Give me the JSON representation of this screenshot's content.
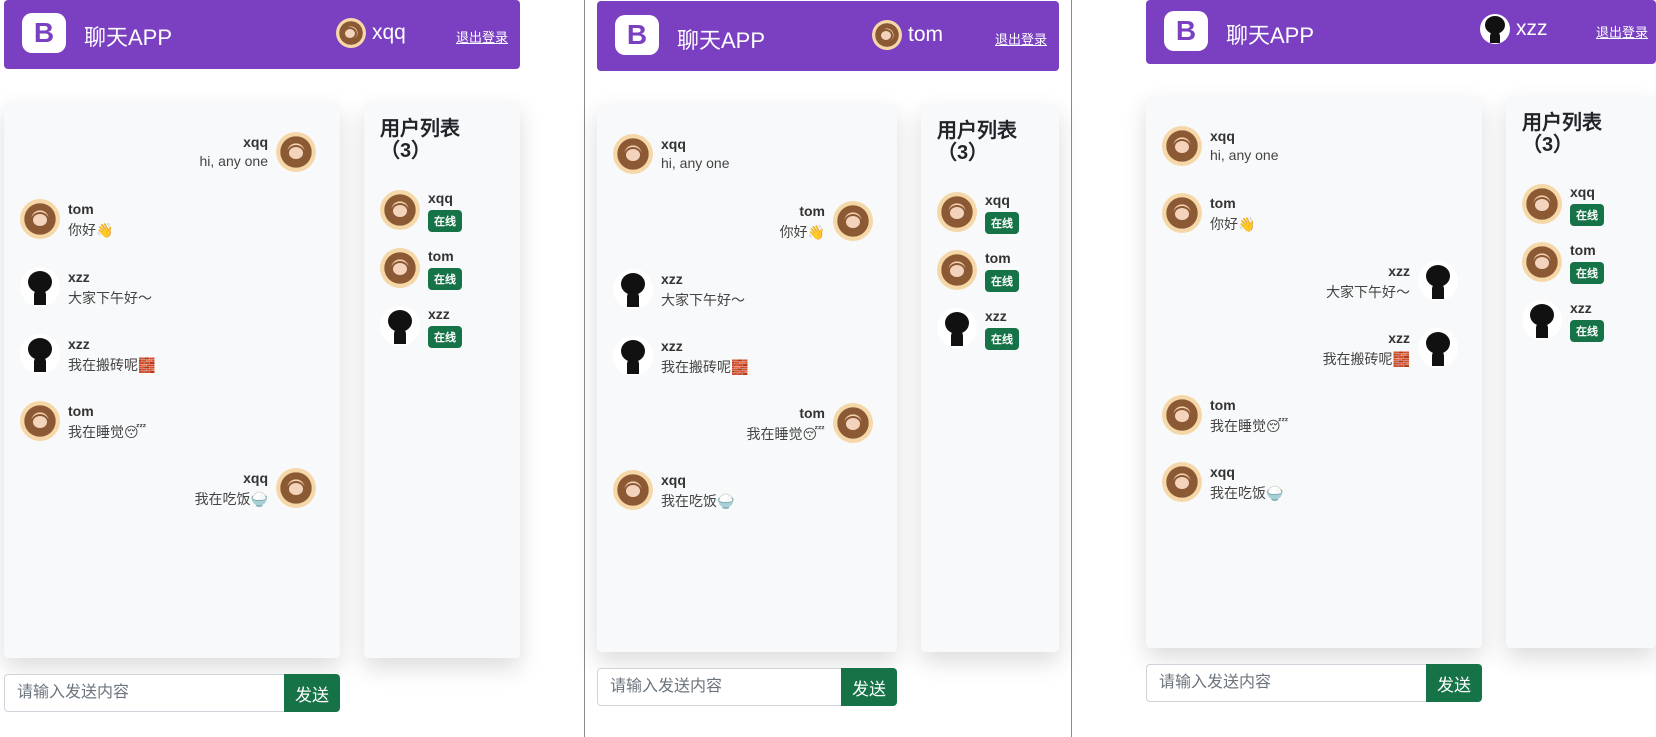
{
  "app": {
    "logo_letter": "B",
    "title": "聊天APP",
    "logout_label": "退出登录",
    "online_label": "在线",
    "send_label": "发送",
    "input_placeholder": "请输入发送内容",
    "users_title_line1": "用户列表",
    "users_title_line2": "（3）",
    "colors": {
      "navbar": "#7a40c1",
      "online_badge": "#157347",
      "send_button": "#157347"
    }
  },
  "windows": [
    {
      "current_user": {
        "name": "xqq",
        "avatar": "girl-avatar"
      },
      "messages": [
        {
          "name": "xqq",
          "text": "hi, any one",
          "align": "right",
          "avatar": "girl-avatar"
        },
        {
          "name": "tom",
          "text": "你好👋",
          "align": "left",
          "avatar": "girl-avatar"
        },
        {
          "name": "xzz",
          "text": "大家下午好～",
          "align": "left",
          "avatar": "black-blob-avatar"
        },
        {
          "name": "xzz",
          "text": "我在搬砖呢🧱",
          "align": "left",
          "avatar": "black-blob-avatar"
        },
        {
          "name": "tom",
          "text": "我在睡觉😴",
          "align": "left",
          "avatar": "girl-avatar"
        },
        {
          "name": "xqq",
          "text": "我在吃饭🍚",
          "align": "right",
          "avatar": "girl-avatar"
        }
      ],
      "users": [
        {
          "name": "xqq",
          "avatar": "girl-avatar"
        },
        {
          "name": "tom",
          "avatar": "girl-avatar"
        },
        {
          "name": "xzz",
          "avatar": "black-blob-avatar"
        }
      ]
    },
    {
      "current_user": {
        "name": "tom",
        "avatar": "girl-avatar"
      },
      "messages": [
        {
          "name": "xqq",
          "text": "hi, any one",
          "align": "left",
          "avatar": "girl-avatar"
        },
        {
          "name": "tom",
          "text": "你好👋",
          "align": "right",
          "avatar": "girl-avatar"
        },
        {
          "name": "xzz",
          "text": "大家下午好～",
          "align": "left",
          "avatar": "black-blob-avatar"
        },
        {
          "name": "xzz",
          "text": "我在搬砖呢🧱",
          "align": "left",
          "avatar": "black-blob-avatar"
        },
        {
          "name": "tom",
          "text": "我在睡觉😴",
          "align": "right",
          "avatar": "girl-avatar"
        },
        {
          "name": "xqq",
          "text": "我在吃饭🍚",
          "align": "left",
          "avatar": "girl-avatar"
        }
      ],
      "users": [
        {
          "name": "xqq",
          "avatar": "girl-avatar"
        },
        {
          "name": "tom",
          "avatar": "girl-avatar"
        },
        {
          "name": "xzz",
          "avatar": "black-blob-avatar"
        }
      ]
    },
    {
      "current_user": {
        "name": "xzz",
        "avatar": "black-blob-avatar"
      },
      "messages": [
        {
          "name": "xqq",
          "text": "hi, any one",
          "align": "left",
          "avatar": "girl-avatar"
        },
        {
          "name": "tom",
          "text": "你好👋",
          "align": "left",
          "avatar": "girl-avatar"
        },
        {
          "name": "xzz",
          "text": "大家下午好～",
          "align": "right",
          "avatar": "black-blob-avatar"
        },
        {
          "name": "xzz",
          "text": "我在搬砖呢🧱",
          "align": "right",
          "avatar": "black-blob-avatar"
        },
        {
          "name": "tom",
          "text": "我在睡觉😴",
          "align": "left",
          "avatar": "girl-avatar"
        },
        {
          "name": "xqq",
          "text": "我在吃饭🍚",
          "align": "left",
          "avatar": "girl-avatar"
        }
      ],
      "users": [
        {
          "name": "xqq",
          "avatar": "girl-avatar"
        },
        {
          "name": "tom",
          "avatar": "girl-avatar"
        },
        {
          "name": "xzz",
          "avatar": "black-blob-avatar"
        }
      ]
    }
  ]
}
